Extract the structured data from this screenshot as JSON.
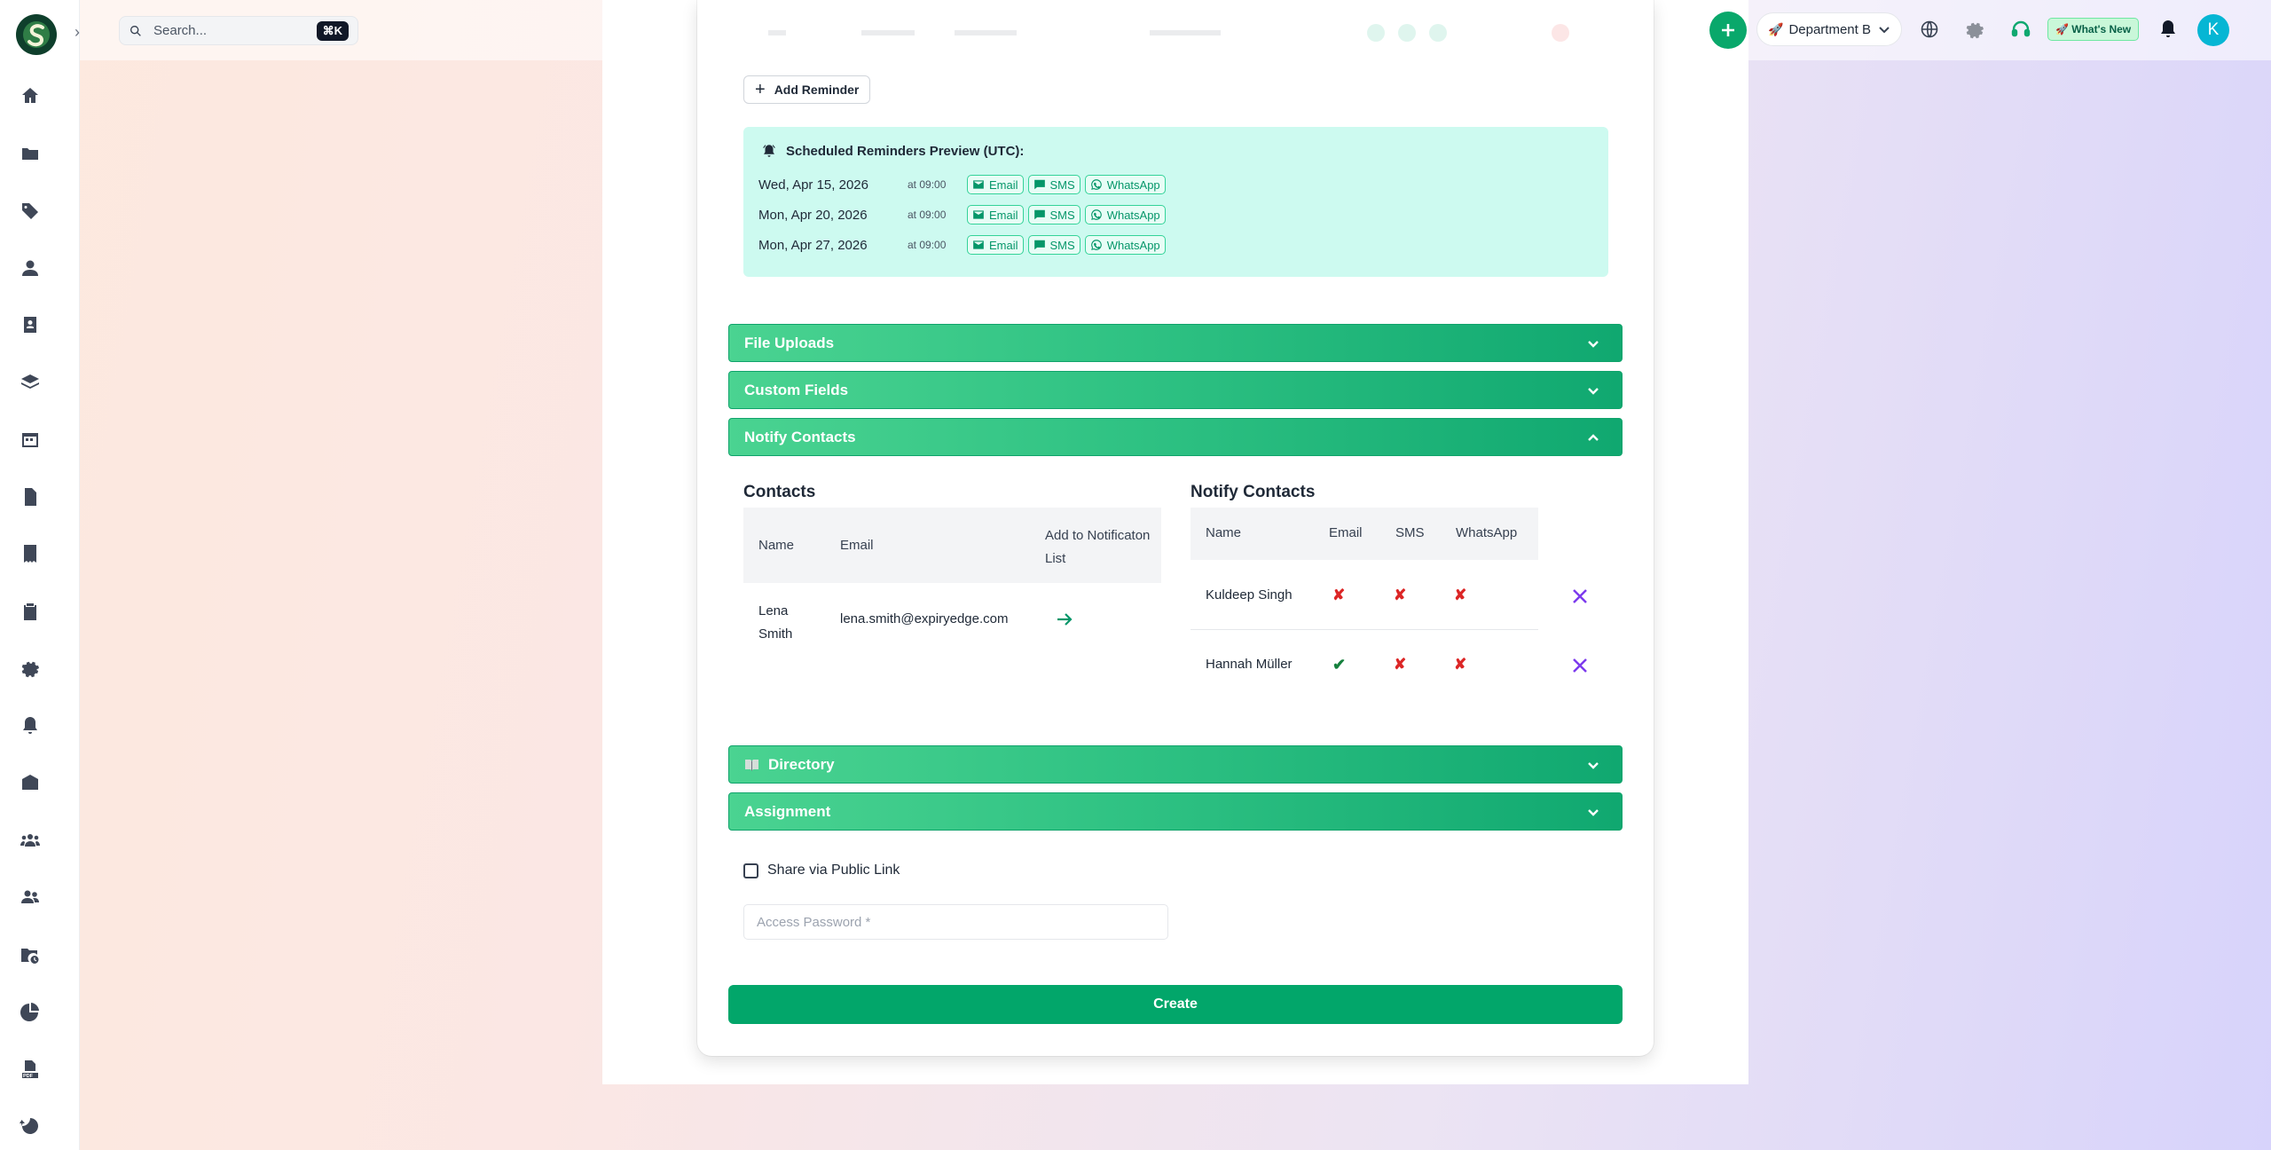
{
  "search": {
    "placeholder": "Search...",
    "shortcut": "⌘K"
  },
  "sidebar": {
    "icons": [
      "home-icon",
      "folder-icon",
      "tag-icon",
      "user-icon",
      "contact-book-icon",
      "layers-icon",
      "calendar-icon",
      "document-icon",
      "receipt-icon",
      "clipboard-check-icon",
      "settings-icon",
      "bell-icon",
      "inbox-icon",
      "team-icon",
      "users-icon",
      "folder-clock-icon",
      "pie-chart-icon",
      "pdf-icon",
      "history-icon"
    ]
  },
  "header": {
    "department": "Department B",
    "department_emoji": "🚀",
    "whats_new": "🚀 What's New",
    "avatar_initial": "K"
  },
  "reminders": {
    "add_label": "Add Reminder",
    "preview_title": "Scheduled Reminders Preview (UTC):",
    "rows": [
      {
        "date": "Wed, Apr 15, 2026",
        "time": "at 09:00",
        "channels": [
          "Email",
          "SMS",
          "WhatsApp"
        ]
      },
      {
        "date": "Mon, Apr 20, 2026",
        "time": "at 09:00",
        "channels": [
          "Email",
          "SMS",
          "WhatsApp"
        ]
      },
      {
        "date": "Mon, Apr 27, 2026",
        "time": "at 09:00",
        "channels": [
          "Email",
          "SMS",
          "WhatsApp"
        ]
      }
    ]
  },
  "sections": {
    "file_uploads": "File Uploads",
    "custom_fields": "Custom Fields",
    "notify_contacts": "Notify Contacts",
    "directory": "Directory",
    "assignment": "Assignment"
  },
  "contacts": {
    "title": "Contacts",
    "headers": [
      "Name",
      "Email",
      "Add to Notificaton List"
    ],
    "rows": [
      {
        "name": "Lena Smith",
        "email": "lena.smith@expiryedge.com"
      }
    ]
  },
  "notify": {
    "title": "Notify Contacts",
    "headers": [
      "Name",
      "Email",
      "SMS",
      "WhatsApp"
    ],
    "rows": [
      {
        "name": "Kuldeep Singh",
        "email": "✘",
        "sms": "✘",
        "whatsapp": "✘"
      },
      {
        "name": "Hannah Müller",
        "email": "✔",
        "sms": "✘",
        "whatsapp": "✘"
      }
    ]
  },
  "share": {
    "label": "Share via Public Link",
    "checked": false
  },
  "password": {
    "placeholder": "Access Password *",
    "value": ""
  },
  "create_label": "Create",
  "colors": {
    "brand": "#09a86b",
    "accordion_end": "#10a870",
    "preview_bg": "#cdfaf0",
    "remove": "#7c3aed"
  }
}
